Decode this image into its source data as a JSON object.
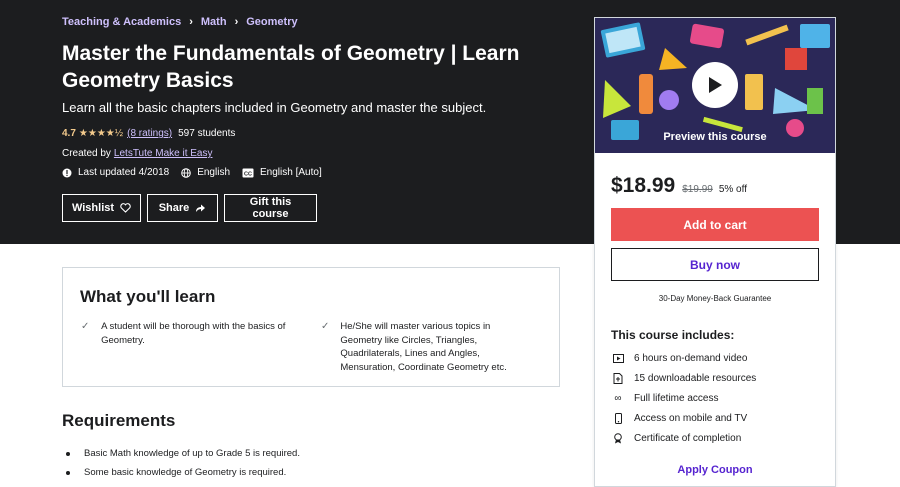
{
  "breadcrumb": [
    "Teaching & Academics",
    "Math",
    "Geometry"
  ],
  "course": {
    "title": "Master the Fundamentals of Geometry | Learn Geometry Basics",
    "subtitle": "Learn all the basic chapters included in Geometry and master the subject.",
    "rating": "4.7",
    "stars": "★★★★½",
    "ratings_count": "(8 ratings)",
    "students": "597 students",
    "created_by_label": "Created by",
    "author": "LetsTute Make it Easy",
    "last_updated": "Last updated 4/2018",
    "language": "English",
    "captions": "English [Auto]"
  },
  "actions": {
    "wishlist": "Wishlist",
    "share": "Share",
    "gift": "Gift this course"
  },
  "sidebar": {
    "preview_label": "Preview this course",
    "price": "$18.99",
    "original_price": "$19.99",
    "discount": "5% off",
    "add_to_cart": "Add to cart",
    "buy_now": "Buy now",
    "guarantee": "30-Day Money-Back Guarantee",
    "includes_title": "This course includes:",
    "includes": [
      {
        "icon": "video-icon",
        "text": "6 hours on-demand video"
      },
      {
        "icon": "file-icon",
        "text": "15 downloadable resources"
      },
      {
        "icon": "infinity-icon",
        "text": "Full lifetime access"
      },
      {
        "icon": "mobile-icon",
        "text": "Access on mobile and TV"
      },
      {
        "icon": "certificate-icon",
        "text": "Certificate of completion"
      }
    ],
    "apply_coupon": "Apply Coupon"
  },
  "learn": {
    "title": "What you'll learn",
    "items": [
      "A student will be thorough with the basics of Geometry.",
      "He/She will master various topics in Geometry like Circles, Triangles, Quadrilaterals, Lines and Angles, Mensuration, Coordinate Geometry etc."
    ]
  },
  "requirements": {
    "title": "Requirements",
    "items": [
      "Basic Math knowledge of up to Grade 5 is required.",
      "Some basic knowledge of Geometry is required."
    ]
  },
  "colors": {
    "hero_bg": "#1c1d1f",
    "accent_purple": "#cec0fc",
    "star": "#f3ca8c",
    "cart_red": "#ec5252",
    "link_purple": "#5624d0"
  }
}
